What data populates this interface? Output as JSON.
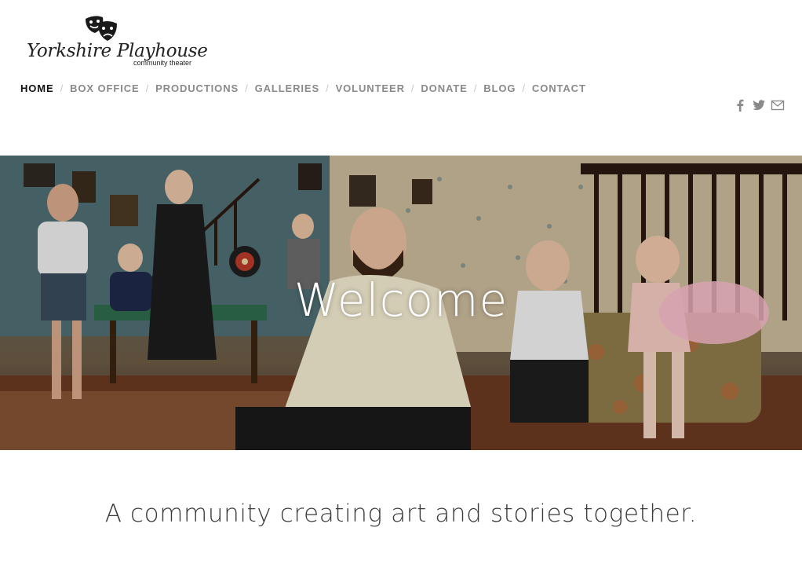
{
  "logo": {
    "script_text": "Yorkshire Playhouse",
    "sub_text": "community theater"
  },
  "nav": {
    "items": [
      {
        "label": "HOME",
        "active": true
      },
      {
        "label": "BOX OFFICE",
        "active": false
      },
      {
        "label": "PRODUCTIONS",
        "active": false
      },
      {
        "label": "GALLERIES",
        "active": false
      },
      {
        "label": "VOLUNTEER",
        "active": false
      },
      {
        "label": "DONATE",
        "active": false
      },
      {
        "label": "BLOG",
        "active": false
      },
      {
        "label": "CONTACT",
        "active": false
      }
    ],
    "separator": "/"
  },
  "social": {
    "icons": [
      "facebook-icon",
      "twitter-icon",
      "mail-icon"
    ],
    "color": "#8a8a8a"
  },
  "hero": {
    "title": "Welcome"
  },
  "tagline": "A community creating art and stories together.",
  "colors": {
    "nav_active": "#111111",
    "nav_inactive": "#8a8a8a",
    "tagline": "#3a3a3a"
  }
}
